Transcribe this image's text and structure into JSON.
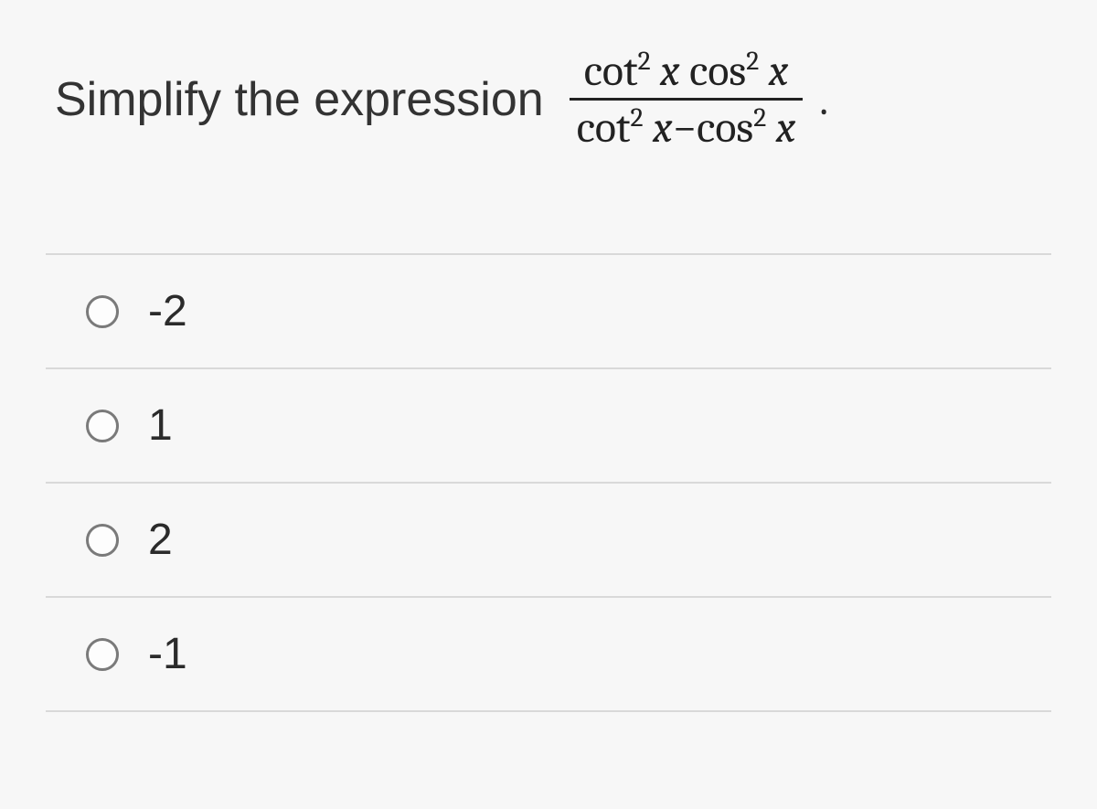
{
  "question": {
    "prompt": "Simplify the expression",
    "fraction": {
      "numerator_html": "cot<sup>2</sup> <span class='x'>x</span> cos<sup>2</sup> <span class='x'>x</span>",
      "denominator_html": "cot<sup>2</sup> <span class='x'>x</span>−cos<sup>2</sup> <span class='x'>x</span>"
    },
    "trailing": "."
  },
  "options": [
    {
      "label": "-2"
    },
    {
      "label": "1"
    },
    {
      "label": "2"
    },
    {
      "label": "-1"
    }
  ]
}
